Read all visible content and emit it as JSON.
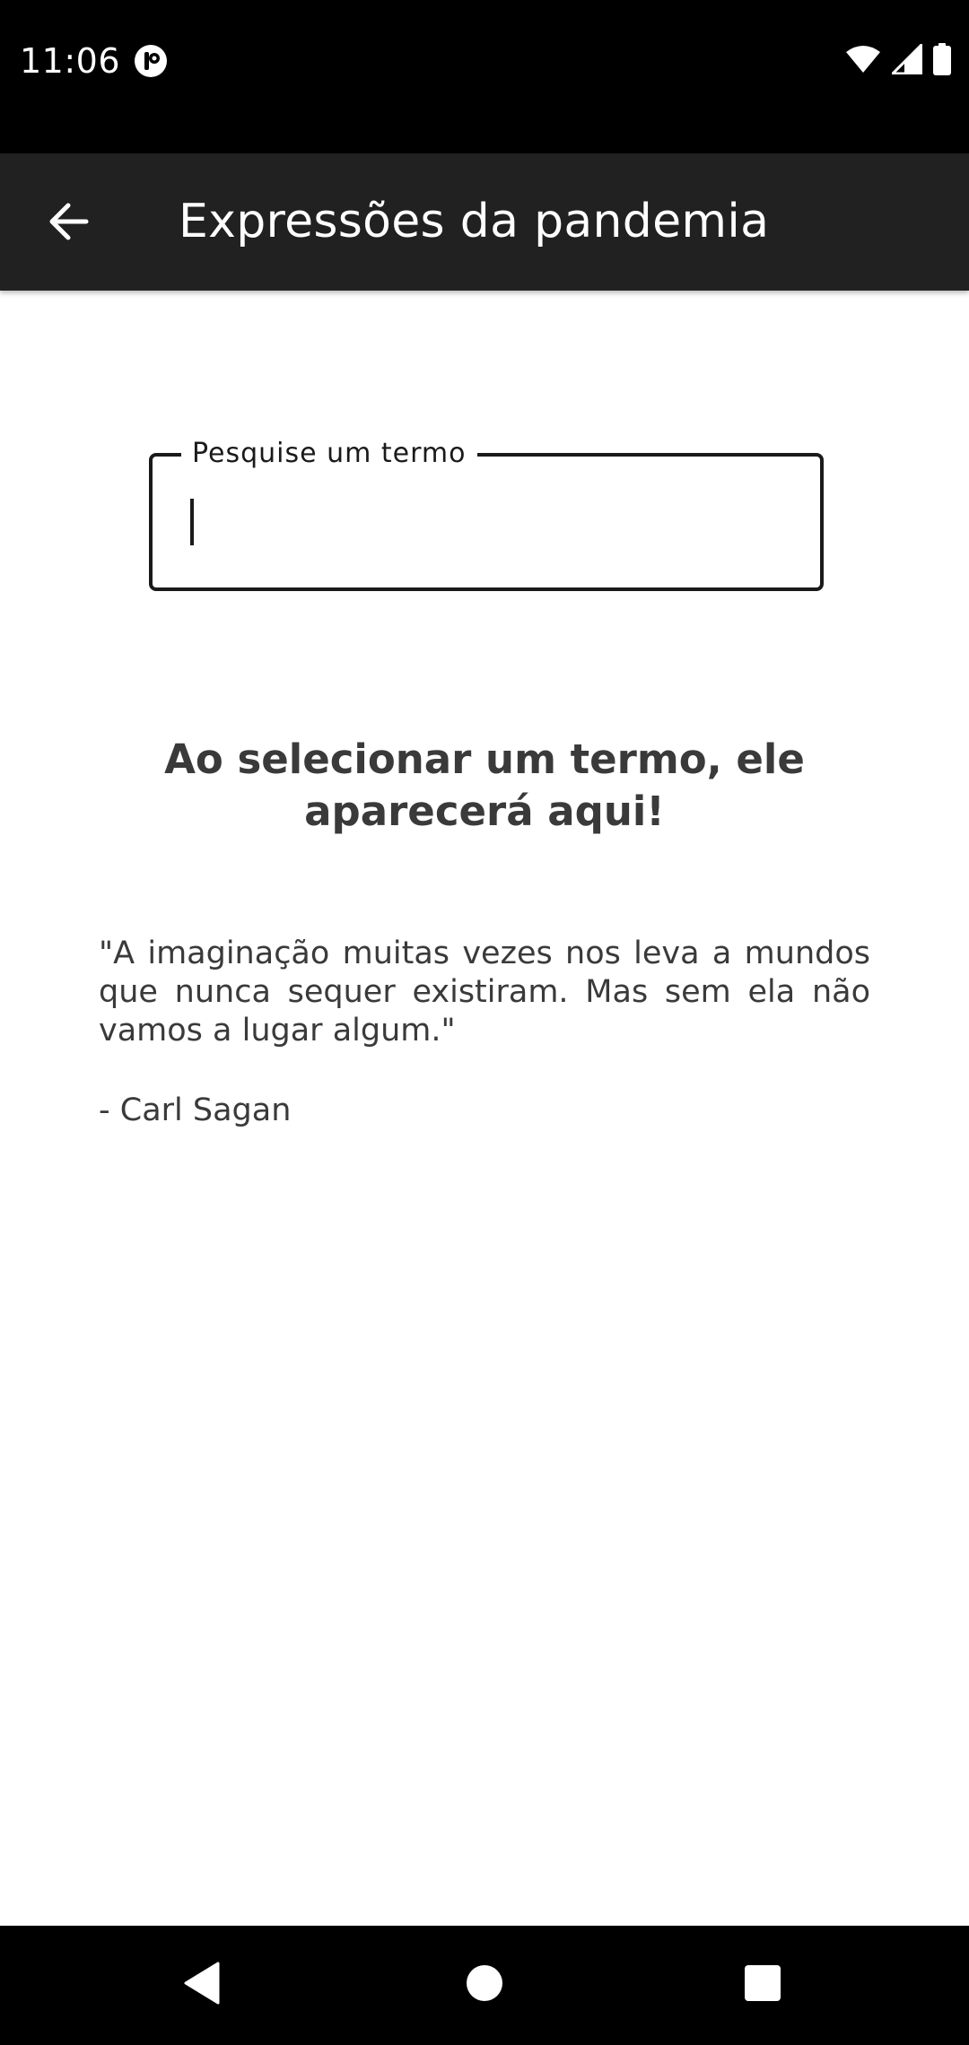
{
  "status_bar": {
    "time": "11:06",
    "icons": [
      "notification-icon",
      "wifi-icon",
      "signal-icon",
      "battery-icon"
    ]
  },
  "app_bar": {
    "title": "Expressões da pandemia",
    "back_icon": "arrow-back-icon"
  },
  "search": {
    "label": "Pesquise um termo",
    "value": ""
  },
  "main": {
    "placeholder_heading": "Ao selecionar um termo, ele aparecerá aqui!",
    "quote": "\"A imaginação muitas vezes nos leva a mundos que nunca sequer existiram. Mas sem ela não vamos a lugar algum.\"",
    "quote_author": "- Carl Sagan"
  },
  "nav_bar": {
    "icons": [
      "back-triangle-icon",
      "home-circle-icon",
      "recents-square-icon"
    ]
  },
  "colors": {
    "status_bar_bg": "#000000",
    "app_bar_bg": "#212121",
    "text_dark": "#3a3a3a",
    "outline": "#1a1a1a"
  }
}
